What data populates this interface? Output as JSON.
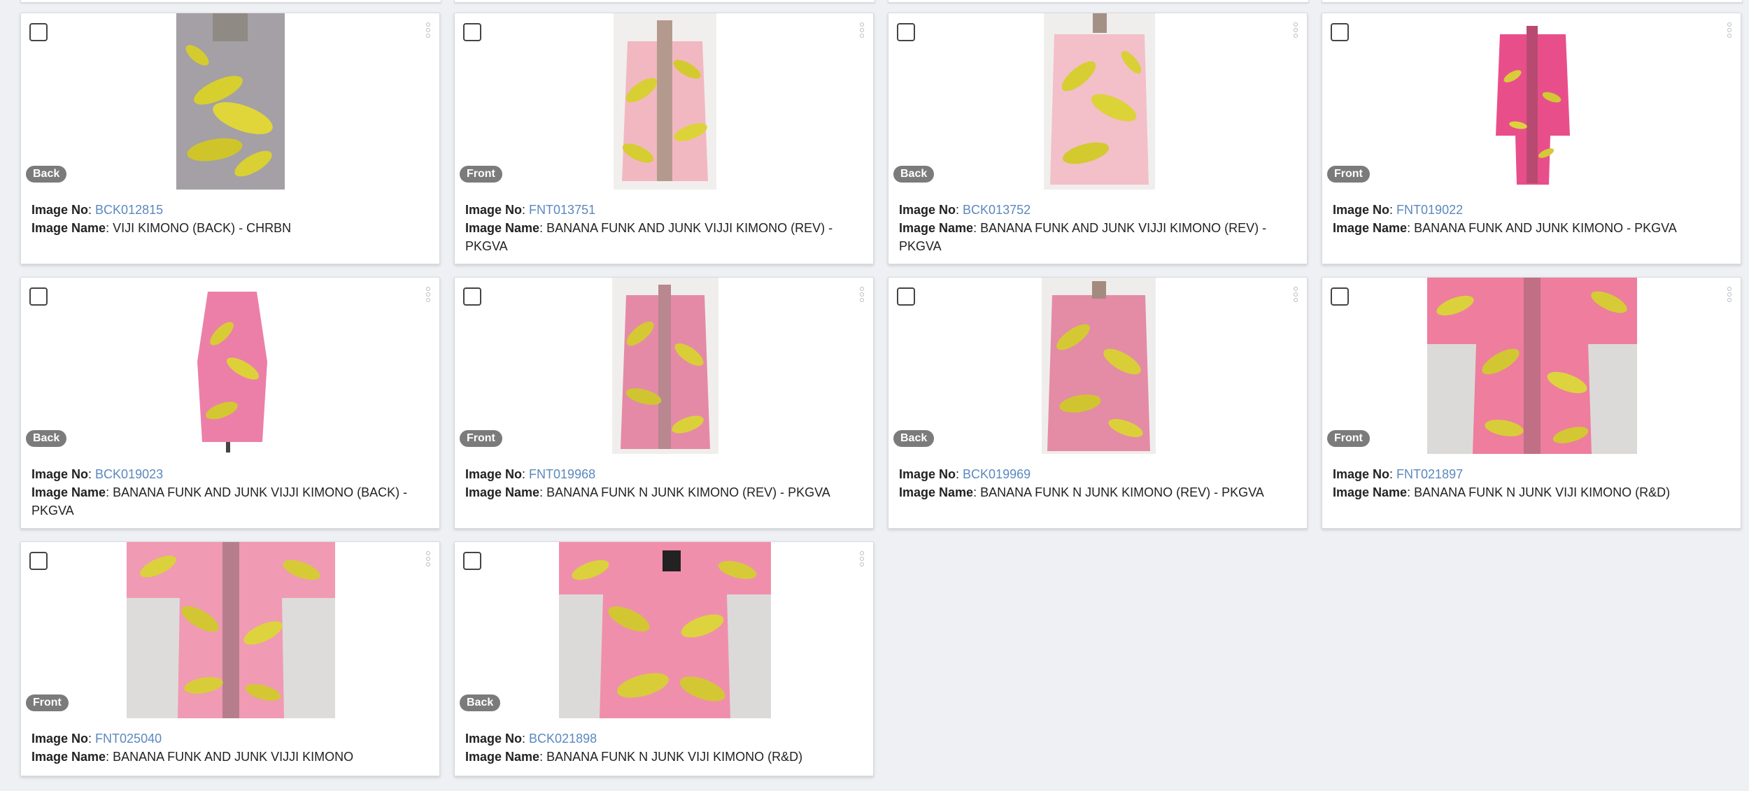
{
  "gallery": {
    "image_no_label": "Image No",
    "image_name_label": "Image Name",
    "cards": [
      {
        "image_no": "BCK012815",
        "image_name": "VIJI KIMONO (BACK) - CHRBN",
        "view": "Back",
        "thumb_style": "grey-back"
      },
      {
        "image_no": "FNT013751",
        "image_name": "BANANA FUNK AND JUNK VIJJI KIMONO (REV) - PKGVA",
        "view": "Front",
        "thumb_style": "pink-light-front"
      },
      {
        "image_no": "BCK013752",
        "image_name": "BANANA FUNK AND JUNK VIJJI KIMONO (REV) - PKGVA",
        "view": "Back",
        "thumb_style": "pink-light-back"
      },
      {
        "image_no": "FNT019022",
        "image_name": "BANANA FUNK AND JUNK KIMONO - PKGVA",
        "view": "Front",
        "thumb_style": "magenta-front"
      },
      {
        "image_no": "BCK019023",
        "image_name": "BANANA FUNK AND JUNK VIJJI KIMONO (BACK) - PKGVA",
        "view": "Back",
        "thumb_style": "pink-side"
      },
      {
        "image_no": "FNT019968",
        "image_name": "BANANA FUNK N JUNK KIMONO (REV) - PKGVA",
        "view": "Front",
        "thumb_style": "pink-dark-front"
      },
      {
        "image_no": "BCK019969",
        "image_name": "BANANA FUNK N JUNK KIMONO (REV) - PKGVA",
        "view": "Back",
        "thumb_style": "pink-dark-back"
      },
      {
        "image_no": "FNT021897",
        "image_name": "BANANA FUNK N JUNK VIJI KIMONO (R&D)",
        "view": "Front",
        "thumb_style": "flat-front"
      },
      {
        "image_no": "FNT025040",
        "image_name": "BANANA FUNK AND JUNK VIJJI KIMONO",
        "view": "Front",
        "thumb_style": "flat-front-light"
      },
      {
        "image_no": "BCK021898",
        "image_name": "BANANA FUNK N JUNK VIJI KIMONO (R&D)",
        "view": "Back",
        "thumb_style": "flat-back"
      }
    ]
  }
}
